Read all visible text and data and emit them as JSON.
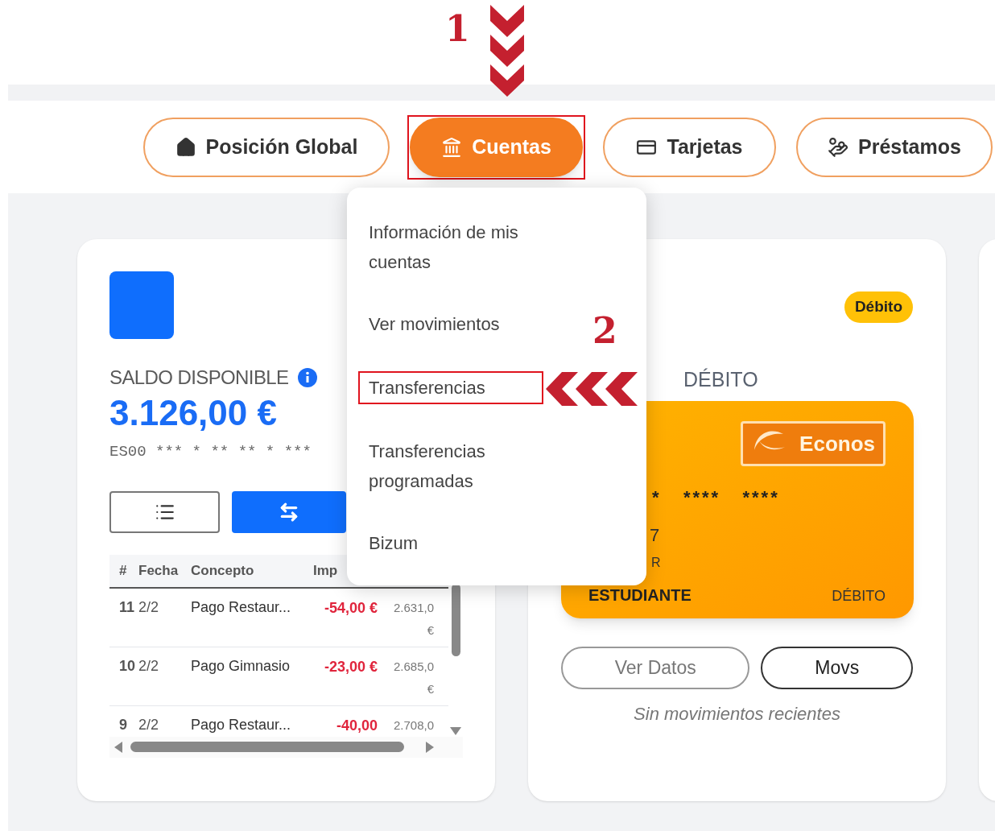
{
  "annotations": {
    "step_1": "1",
    "step_2": "2"
  },
  "nav": {
    "tabs": [
      {
        "label": "Posición Global",
        "kind": "home",
        "selected": false,
        "annotated": false
      },
      {
        "label": "Cuentas",
        "kind": "bank",
        "selected": true,
        "annotated": true
      },
      {
        "label": "Tarjetas",
        "kind": "card",
        "selected": false,
        "annotated": false
      },
      {
        "label": "Préstamos",
        "kind": "loan",
        "selected": false,
        "annotated": false
      }
    ]
  },
  "dropdown": {
    "items": [
      {
        "label": "Información de mis cuentas",
        "annotated": false
      },
      {
        "label": "Ver movimientos",
        "annotated": false
      },
      {
        "label": "Transferencias",
        "annotated": true
      },
      {
        "label": "Transferencias programadas",
        "annotated": false
      },
      {
        "label": "Bizum",
        "annotated": false
      }
    ]
  },
  "account_card": {
    "balance_label": "SALDO DISPONIBLE",
    "balance": "3.126,00 €",
    "iban": "ES00 *** * ** ** * ***",
    "table": {
      "columns": [
        "#",
        "Fecha",
        "Concepto",
        "Imp"
      ],
      "rows": [
        {
          "number": "11",
          "date": "2/2",
          "concept": "Pago Restaur...",
          "amount": "-54,00 €",
          "balance": "2.631,0 €"
        },
        {
          "number": "10",
          "date": "2/2",
          "concept": "Pago Gimnasio",
          "amount": "-23,00 €",
          "balance": "2.685,0 €"
        },
        {
          "number": "9",
          "date": "2/2",
          "concept": "Pago Restaur...",
          "amount": "-40,00",
          "balance": "2.708,0"
        }
      ]
    }
  },
  "card_panel": {
    "badge": "Débito",
    "title": "DÉBITO",
    "card": {
      "brand": "Econos",
      "number": "*   ****   ****",
      "line_1": "7",
      "line_2": "R",
      "holder": "ESTUDIANTE",
      "type": "DÉBITO"
    },
    "buttons": [
      "Ver Datos",
      "Movs"
    ],
    "empty_text": "Sin movimientos recientes"
  }
}
